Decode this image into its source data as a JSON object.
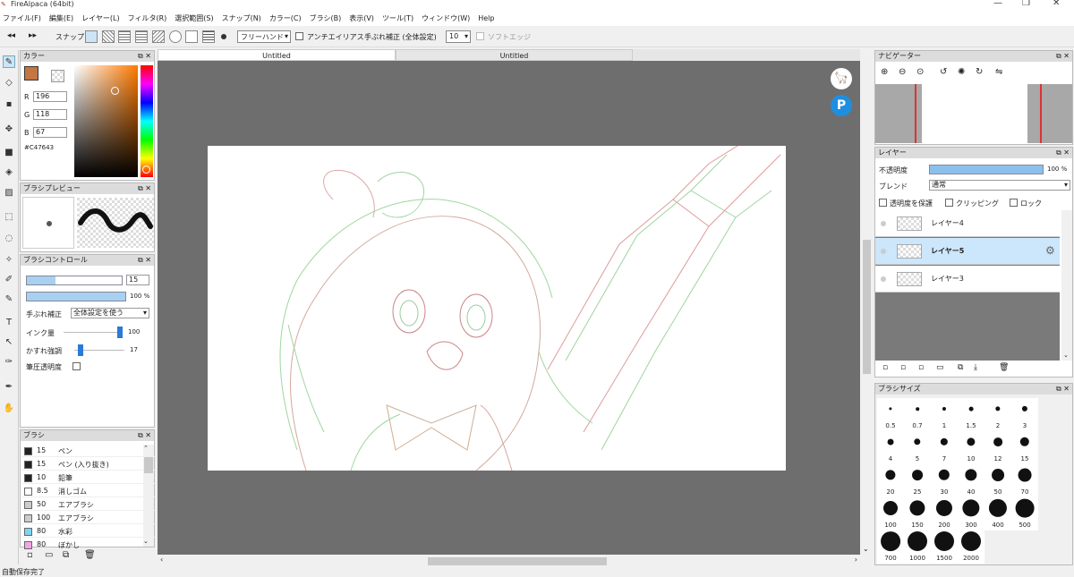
{
  "window": {
    "title": "FireAlpaca (64bit)",
    "controls": [
      "—",
      "❐",
      "✕"
    ]
  },
  "menu": [
    "ファイル(F)",
    "編集(E)",
    "レイヤー(L)",
    "フィルタ(R)",
    "選択範囲(S)",
    "スナップ(N)",
    "カラー(C)",
    "ブラシ(B)",
    "表示(V)",
    "ツール(T)",
    "ウィンドウ(W)",
    "Help"
  ],
  "toolbar": {
    "snap_label": "スナップ",
    "mode": "フリーハンド",
    "antialias_label": "アンチエイリアス",
    "stabilizer_label": "手ぶれ補正 (全体設定)",
    "stabilizer_value": "10",
    "softedge_label": "ソフトエッジ"
  },
  "color_panel": {
    "title": "カラー",
    "r_label": "R",
    "r": "196",
    "g_label": "G",
    "g": "118",
    "b_label": "B",
    "b": "67",
    "hex": "#C47643",
    "current_color": "#C47643"
  },
  "brush_preview": {
    "title": "ブラシプレビュー"
  },
  "brush_control": {
    "title": "ブラシコントロール",
    "size_value": "15",
    "opacity_value": "100 %",
    "stabilizer_label": "手ぶれ補正",
    "stabilizer_option": "全体設定を使う",
    "ink_label": "インク量",
    "ink_value": "100",
    "blur_label": "かすれ強調",
    "blur_value": "17",
    "pressure_label": "筆圧透明度"
  },
  "brush_list": {
    "title": "ブラシ",
    "items": [
      {
        "size": "15",
        "name": "ペン",
        "color": "#222222"
      },
      {
        "size": "15",
        "name": "ペン (入り抜き)",
        "color": "#222222"
      },
      {
        "size": "10",
        "name": "鉛筆",
        "color": "#222222"
      },
      {
        "size": "8.5",
        "name": "消しゴム",
        "color": "#ffffff"
      },
      {
        "size": "50",
        "name": "エアブラシ",
        "color": "#cccccc"
      },
      {
        "size": "100",
        "name": "エアブラシ",
        "color": "#cccccc"
      },
      {
        "size": "80",
        "name": "水彩",
        "color": "#7fd6f0"
      },
      {
        "size": "80",
        "name": "ぼかし",
        "color": "#f3a6e6"
      }
    ]
  },
  "tabs": [
    "Untitled",
    "Untitled"
  ],
  "navigator": {
    "title": "ナビゲーター"
  },
  "layers": {
    "title": "レイヤー",
    "opacity_label": "不透明度",
    "opacity_value": "100 %",
    "opacity_fraction": 1.0,
    "blend_label": "ブレンド",
    "blend_value": "通常",
    "protect_label": "透明度を保護",
    "clip_label": "クリッピング",
    "lock_label": "ロック",
    "items": [
      {
        "name": "レイヤー4",
        "selected": false
      },
      {
        "name": "レイヤー5",
        "selected": true
      },
      {
        "name": "レイヤー3",
        "selected": false
      }
    ]
  },
  "brush_sizes": {
    "title": "ブラシサイズ",
    "items": [
      "0.5",
      "0.7",
      "1",
      "1.5",
      "2",
      "3",
      "4",
      "5",
      "7",
      "10",
      "12",
      "15",
      "20",
      "25",
      "30",
      "40",
      "50",
      "70",
      "100",
      "150",
      "200",
      "300",
      "400",
      "500",
      "700",
      "1000",
      "1500",
      "2000"
    ]
  },
  "status": "自動保存完了"
}
